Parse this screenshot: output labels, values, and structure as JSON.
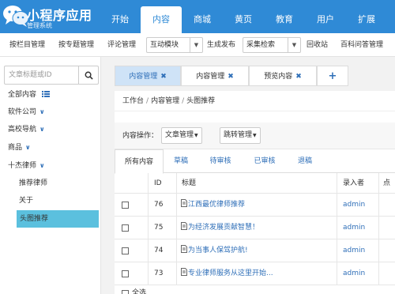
{
  "brand": {
    "title": "小程序应用",
    "subtitle": "管理系统"
  },
  "topnav": [
    {
      "label": "开始",
      "active": false
    },
    {
      "label": "内容",
      "active": true
    },
    {
      "label": "商城",
      "active": false
    },
    {
      "label": "黄页",
      "active": false
    },
    {
      "label": "教育",
      "active": false
    },
    {
      "label": "用户",
      "active": false
    },
    {
      "label": "扩展",
      "active": false
    }
  ],
  "toolbar": {
    "items": [
      "按栏目管理",
      "按专题管理",
      "评论管理"
    ],
    "select1": "互动模块",
    "item4": "生成发布",
    "select2": "采集检索",
    "item5": "回收站",
    "item6": "百科问答管理"
  },
  "sidebar": {
    "search_placeholder": "文章标题或ID",
    "items": [
      {
        "label": "全部内容",
        "icon": "list-icon"
      },
      {
        "label": "软件公司",
        "icon": "chevron-down-icon"
      },
      {
        "label": "高校导航",
        "icon": "chevron-down-icon"
      },
      {
        "label": "商品",
        "icon": "chevron-down-icon"
      },
      {
        "label": "十杰律师",
        "icon": "chevron-down-icon"
      }
    ],
    "subitems": [
      {
        "label": "推荐律师",
        "active": false
      },
      {
        "label": "关于",
        "active": false
      },
      {
        "label": "头图推荐",
        "active": true
      }
    ]
  },
  "tabs": [
    {
      "label": "内容管理",
      "active": true
    },
    {
      "label": "内容管理",
      "active": false
    },
    {
      "label": "预览内容",
      "active": false
    }
  ],
  "breadcrumb": [
    "工作台",
    "内容管理",
    "头图推荐"
  ],
  "operations": {
    "label": "内容操作：",
    "btn1": "文章管理",
    "btn2": "跳转管理"
  },
  "subtabs": [
    "所有内容",
    "草稿",
    "待审核",
    "已审核",
    "退稿"
  ],
  "table": {
    "headers": [
      "ID",
      "标题",
      "录入者",
      "点"
    ],
    "rows": [
      {
        "id": "76",
        "title": "江西最优律师推荐",
        "author": "admin"
      },
      {
        "id": "75",
        "title": "为经济发展贡献智慧！",
        "author": "admin"
      },
      {
        "id": "74",
        "title": "为当事人保驾护航!",
        "author": "admin"
      },
      {
        "id": "73",
        "title": "专业律师服务从这里开始...",
        "author": "admin"
      }
    ],
    "select_all": "全选"
  },
  "colors": {
    "header": "#2f8ad6",
    "link": "#2f6fb8",
    "active_sidebar": "#5bc0de",
    "active_tab": "#cfe3f7"
  }
}
